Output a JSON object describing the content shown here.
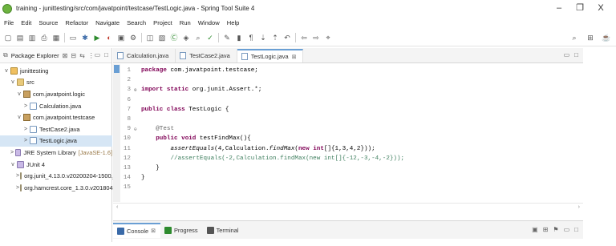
{
  "window": {
    "title": "training - junittesting/src/com/javatpoint/testcase/TestLogic.java - Spring Tool Suite 4",
    "minimize": "–",
    "maximize": "❐",
    "close": "X"
  },
  "menu": [
    "File",
    "Edit",
    "Source",
    "Refactor",
    "Navigate",
    "Search",
    "Project",
    "Run",
    "Window",
    "Help"
  ],
  "toolbar": {
    "icons": [
      "new-icon",
      "save-icon",
      "save-all-icon",
      "print-icon",
      "build-icon",
      "terminal-icon",
      "debug-icon",
      "run-icon",
      "coverage-icon",
      "server-icon",
      "external-tools-icon",
      "new-java-project-icon",
      "new-package-icon",
      "new-class-icon",
      "open-type-icon",
      "search-icon",
      "task-icon",
      "mark-occurrences-icon",
      "toggle-block-icon",
      "show-whitespace-icon",
      "next-annotation-icon",
      "prev-annotation-icon",
      "last-edit-icon",
      "back-icon",
      "forward-icon",
      "pin-editor-icon"
    ],
    "right_icons": [
      "quick-access-icon",
      "open-perspective-icon",
      "java-perspective-icon"
    ]
  },
  "explorer": {
    "title": "Package Explorer",
    "close": "⊠",
    "tree": [
      {
        "label": "junittesting",
        "depth": 0,
        "twisty": "v",
        "icon": "project",
        "selected": false,
        "decor": ""
      },
      {
        "label": "src",
        "depth": 1,
        "twisty": "v",
        "icon": "folder",
        "selected": false,
        "decor": ""
      },
      {
        "label": "com.javatpoint.logic",
        "depth": 2,
        "twisty": "v",
        "icon": "package",
        "selected": false,
        "decor": ""
      },
      {
        "label": "Calculation.java",
        "depth": 3,
        "twisty": ">",
        "icon": "java",
        "selected": false,
        "decor": ""
      },
      {
        "label": "com.javatpoint.testcase",
        "depth": 2,
        "twisty": "v",
        "icon": "package",
        "selected": false,
        "decor": ""
      },
      {
        "label": "TestCase2.java",
        "depth": 3,
        "twisty": ">",
        "icon": "java",
        "selected": false,
        "decor": ""
      },
      {
        "label": "TestLogic.java",
        "depth": 3,
        "twisty": ">",
        "icon": "java",
        "selected": true,
        "decor": ""
      },
      {
        "label": "JRE System Library",
        "depth": 1,
        "twisty": ">",
        "icon": "library",
        "selected": false,
        "decor": "[JavaSE-1.6]"
      },
      {
        "label": "JUnit 4",
        "depth": 1,
        "twisty": "v",
        "icon": "library",
        "selected": false,
        "decor": ""
      },
      {
        "label": "org.junit_4.13.0.v20200204-1500.jar",
        "depth": 2,
        "twisty": ">",
        "icon": "jar",
        "selected": false,
        "decor": ""
      },
      {
        "label": "org.hamcrest.core_1.3.0.v20180420-",
        "depth": 2,
        "twisty": ">",
        "icon": "jar",
        "selected": false,
        "decor": ""
      }
    ]
  },
  "editor": {
    "tabs": [
      {
        "label": "Calculation.java",
        "active": false,
        "closable": false
      },
      {
        "label": "TestCase2.java",
        "active": false,
        "closable": false
      },
      {
        "label": "TestLogic.java",
        "active": true,
        "closable": true
      }
    ],
    "tab_close": "⊠",
    "lines": [
      {
        "n": "1",
        "fold": "",
        "segs": [
          {
            "t": "package",
            "c": "kw"
          },
          {
            "t": " com.javatpoint.testcase;",
            "c": ""
          }
        ]
      },
      {
        "n": "2",
        "fold": "",
        "segs": []
      },
      {
        "n": "3",
        "fold": "⊕",
        "segs": [
          {
            "t": "import static",
            "c": "kw"
          },
          {
            "t": " org.junit.Assert.*;",
            "c": ""
          }
        ]
      },
      {
        "n": "6",
        "fold": "",
        "segs": []
      },
      {
        "n": "7",
        "fold": "",
        "segs": [
          {
            "t": "public class",
            "c": "kw"
          },
          {
            "t": " TestLogic {",
            "c": ""
          }
        ]
      },
      {
        "n": "8",
        "fold": "",
        "segs": []
      },
      {
        "n": "9",
        "fold": "⊖",
        "segs": [
          {
            "t": "    @Test",
            "c": "ann"
          }
        ]
      },
      {
        "n": "10",
        "fold": "",
        "segs": [
          {
            "t": "    ",
            "c": ""
          },
          {
            "t": "public void",
            "c": "kw"
          },
          {
            "t": " testFindMax(){",
            "c": ""
          }
        ]
      },
      {
        "n": "11",
        "fold": "",
        "segs": [
          {
            "t": "        ",
            "c": ""
          },
          {
            "t": "assertEquals",
            "c": "it"
          },
          {
            "t": "(4,Calculation.",
            "c": ""
          },
          {
            "t": "findMax",
            "c": "it"
          },
          {
            "t": "(",
            "c": ""
          },
          {
            "t": "new int",
            "c": "kw"
          },
          {
            "t": "[]{1,3,4,2}));",
            "c": ""
          }
        ]
      },
      {
        "n": "12",
        "fold": "",
        "segs": [
          {
            "t": "        //assertEquals(-2,Calculation.findMax(new int[]{-12,-3,-4,-2}));",
            "c": "cm"
          }
        ]
      },
      {
        "n": "13",
        "fold": "",
        "segs": [
          {
            "t": "    }",
            "c": ""
          }
        ]
      },
      {
        "n": "14",
        "fold": "",
        "segs": [
          {
            "t": "}",
            "c": ""
          }
        ]
      },
      {
        "n": "15",
        "fold": "",
        "segs": []
      }
    ]
  },
  "bottom": {
    "tabs": [
      {
        "label": "Console",
        "active": true,
        "closable": true
      },
      {
        "label": "Progress",
        "active": false,
        "closable": false
      },
      {
        "label": "Terminal",
        "active": false,
        "closable": false
      }
    ]
  }
}
